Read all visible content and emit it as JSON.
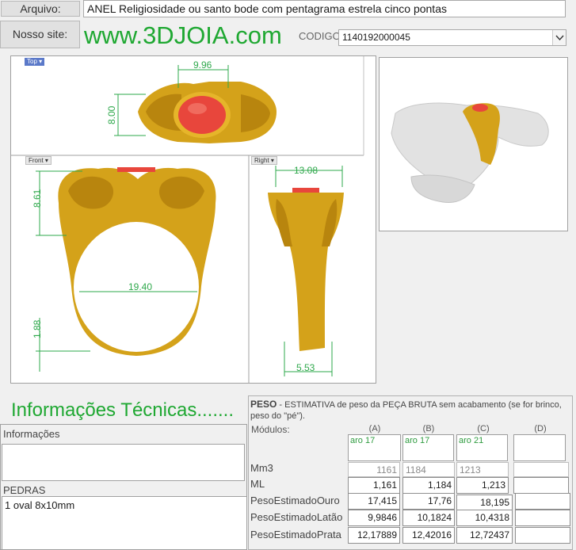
{
  "header": {
    "arquivo_label": "Arquivo:",
    "arquivo_value": "ANEL Religiosidade ou santo bode com pentagrama estrela cinco pontas",
    "site_label": "Nosso site:",
    "site_url": "www.3DJOIA.com",
    "codigo_label": "CODIGO",
    "codigo_value": "1140192000045"
  },
  "views": {
    "top_tag": "Top",
    "front_tag": "Front",
    "right_tag": "Right",
    "top_dims": {
      "width": "9.96",
      "height": "8.00"
    },
    "front_dims": {
      "height": "8.61",
      "inner": "19.40",
      "band": "1.88"
    },
    "right_dims": {
      "top": "13.08",
      "bottom": "5.53"
    }
  },
  "tech": {
    "title": "Informações Técnicas.......",
    "informacoes_label": "Informações",
    "informacoes_value": "",
    "pedras_label": "PEDRAS",
    "pedras_value": "1 oval 8x10mm"
  },
  "peso": {
    "title": "PESO",
    "description": "-  ESTIMATIVA de peso da PEÇA BRUTA sem acabamento (se for brinco, peso do \"pé\").",
    "modulos_label": "Módulos:",
    "columns": [
      "(A)",
      "(B)",
      "(C)",
      "(D)"
    ],
    "aros": [
      "aro 17",
      "aro 17",
      "aro 21",
      ""
    ],
    "rows": [
      {
        "label": "Mm3",
        "values": [
          "1161",
          "1184",
          "1213",
          ""
        ]
      },
      {
        "label": "ML",
        "values": [
          "1,161",
          "1,184",
          "1,213",
          ""
        ]
      },
      {
        "label": "PesoEstimadoOuro",
        "values": [
          "17,415",
          "17,76",
          "18,195",
          ""
        ]
      },
      {
        "label": "PesoEstimadoLatão",
        "values": [
          "9,9846",
          "10,1824",
          "10,4318",
          ""
        ]
      },
      {
        "label": "PesoEstimadoPrata",
        "values": [
          "12,17889",
          "12,42016",
          "12,72437",
          ""
        ]
      }
    ]
  },
  "colors": {
    "site_green": "#1fa832",
    "dim_green": "#2ea84b",
    "gold": "#d4a21a",
    "stone": "#e8463c"
  }
}
